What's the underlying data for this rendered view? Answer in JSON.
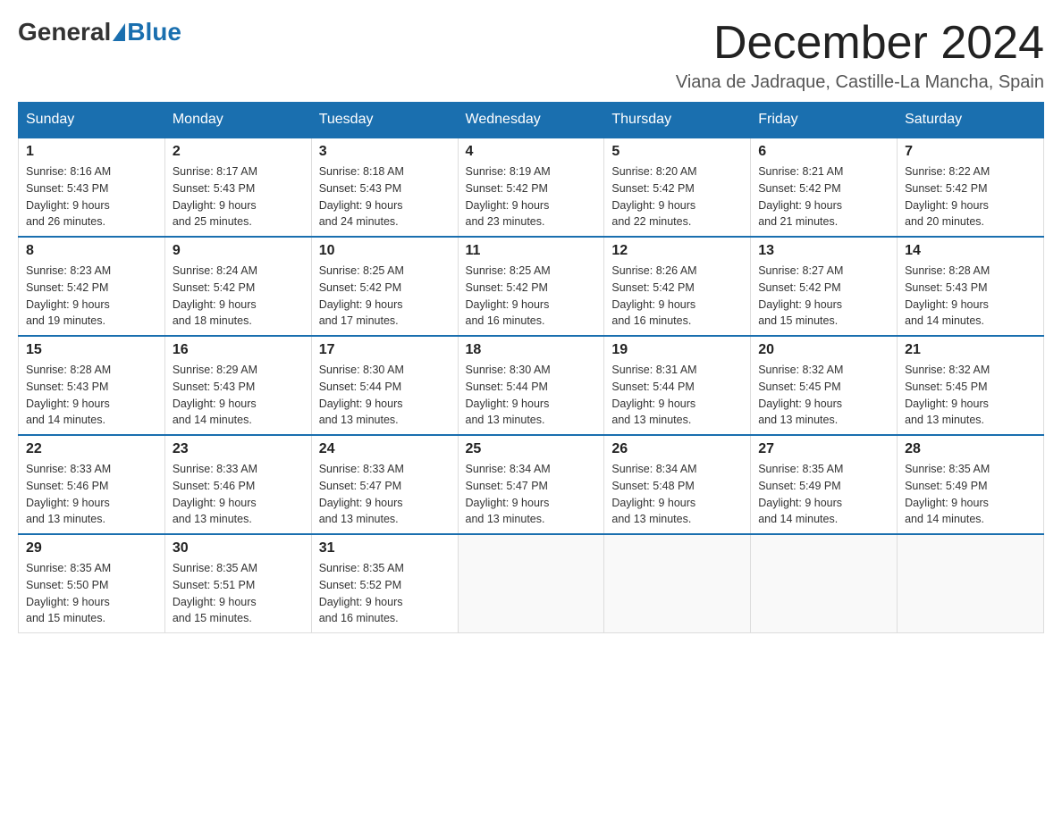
{
  "header": {
    "logo_general": "General",
    "logo_blue": "Blue",
    "month_title": "December 2024",
    "location": "Viana de Jadraque, Castille-La Mancha, Spain"
  },
  "days_of_week": [
    "Sunday",
    "Monday",
    "Tuesday",
    "Wednesday",
    "Thursday",
    "Friday",
    "Saturday"
  ],
  "weeks": [
    [
      {
        "day": "1",
        "sunrise": "8:16 AM",
        "sunset": "5:43 PM",
        "daylight": "9 hours and 26 minutes."
      },
      {
        "day": "2",
        "sunrise": "8:17 AM",
        "sunset": "5:43 PM",
        "daylight": "9 hours and 25 minutes."
      },
      {
        "day": "3",
        "sunrise": "8:18 AM",
        "sunset": "5:43 PM",
        "daylight": "9 hours and 24 minutes."
      },
      {
        "day": "4",
        "sunrise": "8:19 AM",
        "sunset": "5:42 PM",
        "daylight": "9 hours and 23 minutes."
      },
      {
        "day": "5",
        "sunrise": "8:20 AM",
        "sunset": "5:42 PM",
        "daylight": "9 hours and 22 minutes."
      },
      {
        "day": "6",
        "sunrise": "8:21 AM",
        "sunset": "5:42 PM",
        "daylight": "9 hours and 21 minutes."
      },
      {
        "day": "7",
        "sunrise": "8:22 AM",
        "sunset": "5:42 PM",
        "daylight": "9 hours and 20 minutes."
      }
    ],
    [
      {
        "day": "8",
        "sunrise": "8:23 AM",
        "sunset": "5:42 PM",
        "daylight": "9 hours and 19 minutes."
      },
      {
        "day": "9",
        "sunrise": "8:24 AM",
        "sunset": "5:42 PM",
        "daylight": "9 hours and 18 minutes."
      },
      {
        "day": "10",
        "sunrise": "8:25 AM",
        "sunset": "5:42 PM",
        "daylight": "9 hours and 17 minutes."
      },
      {
        "day": "11",
        "sunrise": "8:25 AM",
        "sunset": "5:42 PM",
        "daylight": "9 hours and 16 minutes."
      },
      {
        "day": "12",
        "sunrise": "8:26 AM",
        "sunset": "5:42 PM",
        "daylight": "9 hours and 16 minutes."
      },
      {
        "day": "13",
        "sunrise": "8:27 AM",
        "sunset": "5:42 PM",
        "daylight": "9 hours and 15 minutes."
      },
      {
        "day": "14",
        "sunrise": "8:28 AM",
        "sunset": "5:43 PM",
        "daylight": "9 hours and 14 minutes."
      }
    ],
    [
      {
        "day": "15",
        "sunrise": "8:28 AM",
        "sunset": "5:43 PM",
        "daylight": "9 hours and 14 minutes."
      },
      {
        "day": "16",
        "sunrise": "8:29 AM",
        "sunset": "5:43 PM",
        "daylight": "9 hours and 14 minutes."
      },
      {
        "day": "17",
        "sunrise": "8:30 AM",
        "sunset": "5:44 PM",
        "daylight": "9 hours and 13 minutes."
      },
      {
        "day": "18",
        "sunrise": "8:30 AM",
        "sunset": "5:44 PM",
        "daylight": "9 hours and 13 minutes."
      },
      {
        "day": "19",
        "sunrise": "8:31 AM",
        "sunset": "5:44 PM",
        "daylight": "9 hours and 13 minutes."
      },
      {
        "day": "20",
        "sunrise": "8:32 AM",
        "sunset": "5:45 PM",
        "daylight": "9 hours and 13 minutes."
      },
      {
        "day": "21",
        "sunrise": "8:32 AM",
        "sunset": "5:45 PM",
        "daylight": "9 hours and 13 minutes."
      }
    ],
    [
      {
        "day": "22",
        "sunrise": "8:33 AM",
        "sunset": "5:46 PM",
        "daylight": "9 hours and 13 minutes."
      },
      {
        "day": "23",
        "sunrise": "8:33 AM",
        "sunset": "5:46 PM",
        "daylight": "9 hours and 13 minutes."
      },
      {
        "day": "24",
        "sunrise": "8:33 AM",
        "sunset": "5:47 PM",
        "daylight": "9 hours and 13 minutes."
      },
      {
        "day": "25",
        "sunrise": "8:34 AM",
        "sunset": "5:47 PM",
        "daylight": "9 hours and 13 minutes."
      },
      {
        "day": "26",
        "sunrise": "8:34 AM",
        "sunset": "5:48 PM",
        "daylight": "9 hours and 13 minutes."
      },
      {
        "day": "27",
        "sunrise": "8:35 AM",
        "sunset": "5:49 PM",
        "daylight": "9 hours and 14 minutes."
      },
      {
        "day": "28",
        "sunrise": "8:35 AM",
        "sunset": "5:49 PM",
        "daylight": "9 hours and 14 minutes."
      }
    ],
    [
      {
        "day": "29",
        "sunrise": "8:35 AM",
        "sunset": "5:50 PM",
        "daylight": "9 hours and 15 minutes."
      },
      {
        "day": "30",
        "sunrise": "8:35 AM",
        "sunset": "5:51 PM",
        "daylight": "9 hours and 15 minutes."
      },
      {
        "day": "31",
        "sunrise": "8:35 AM",
        "sunset": "5:52 PM",
        "daylight": "9 hours and 16 minutes."
      },
      null,
      null,
      null,
      null
    ]
  ],
  "labels": {
    "sunrise_prefix": "Sunrise: ",
    "sunset_prefix": "Sunset: ",
    "daylight_prefix": "Daylight: "
  }
}
